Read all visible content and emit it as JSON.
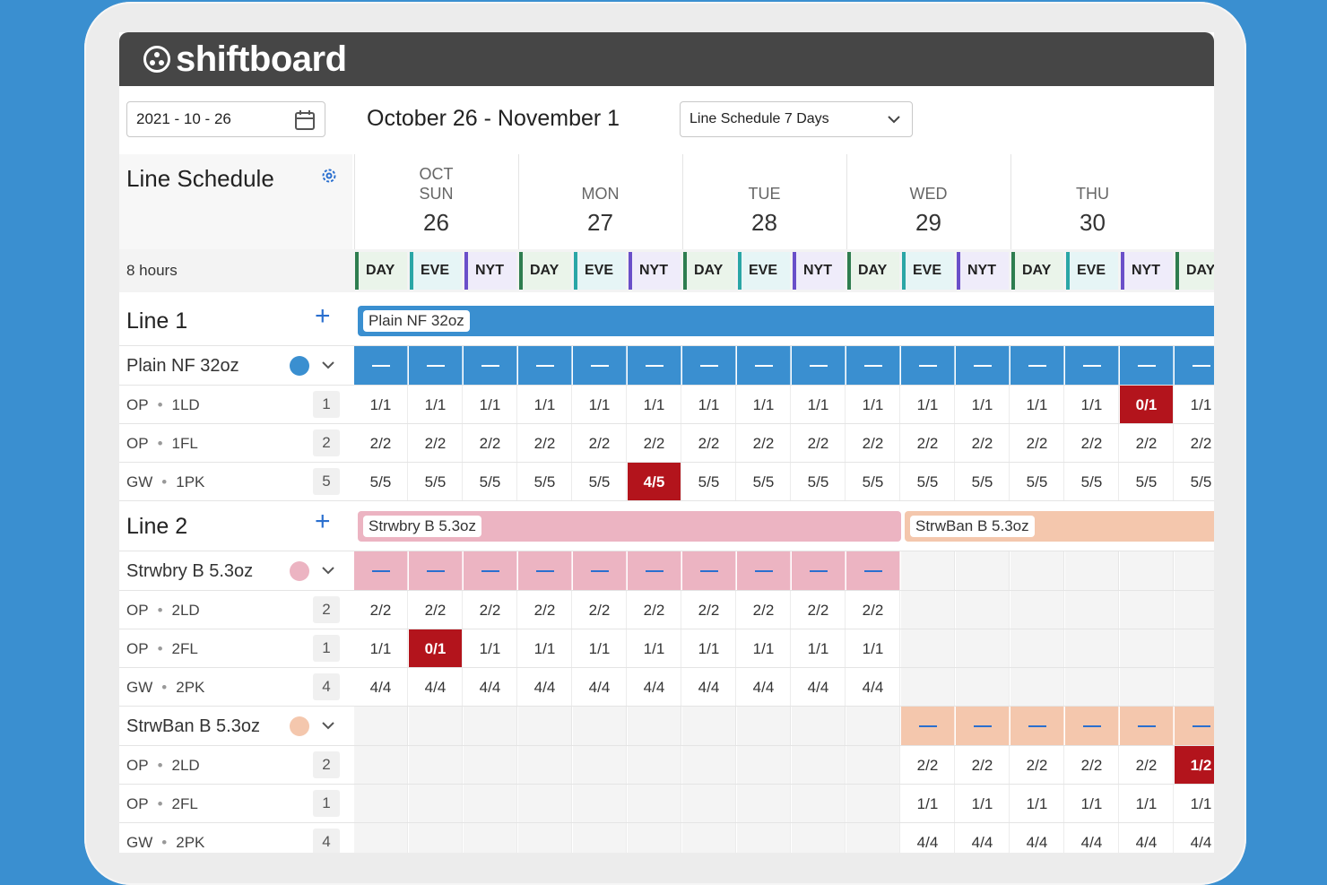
{
  "brand": {
    "name": "shiftboard"
  },
  "toolbar": {
    "date_value": "2021 - 10 - 26",
    "range_title": "October 26 - November 1",
    "view_select": "Line Schedule 7 Days"
  },
  "schedule": {
    "title": "Line Schedule",
    "hours_label": "8 hours",
    "days": [
      {
        "month": "OCT",
        "dow": "SUN",
        "num": "26"
      },
      {
        "month": "",
        "dow": "MON",
        "num": "27"
      },
      {
        "month": "",
        "dow": "TUE",
        "num": "28"
      },
      {
        "month": "",
        "dow": "WED",
        "num": "29"
      },
      {
        "month": "",
        "dow": "THU",
        "num": "30"
      }
    ],
    "shifts": [
      "DAY",
      "EVE",
      "NYT",
      "DAY",
      "EVE",
      "NYT",
      "DAY",
      "EVE",
      "NYT",
      "DAY",
      "EVE",
      "NYT",
      "DAY",
      "EVE",
      "NYT",
      "DAY"
    ]
  },
  "colors": {
    "product_blue": "#3a8fd0",
    "product_pink": "#ecb4c2",
    "product_peach": "#f4c7ad",
    "alert_red": "#b3141c"
  },
  "lines": [
    {
      "title": "Line 1",
      "bars": [
        {
          "label": "Plain NF 32oz",
          "color": "#3a8fd0",
          "start": 0,
          "span": 16
        }
      ],
      "products": [
        {
          "name": "Plain NF 32oz",
          "dot": "#3a8fd0",
          "color": "#3a8fd0",
          "dash_color": "#ffffff",
          "start": 0,
          "span": 16,
          "roles": [
            {
              "group": "OP",
              "code": "1LD",
              "count": "1",
              "values": [
                "1/1",
                "1/1",
                "1/1",
                "1/1",
                "1/1",
                "1/1",
                "1/1",
                "1/1",
                "1/1",
                "1/1",
                "1/1",
                "1/1",
                "1/1",
                "1/1",
                "0/1",
                "1/1"
              ],
              "alerts": [
                14
              ]
            },
            {
              "group": "OP",
              "code": "1FL",
              "count": "2",
              "values": [
                "2/2",
                "2/2",
                "2/2",
                "2/2",
                "2/2",
                "2/2",
                "2/2",
                "2/2",
                "2/2",
                "2/2",
                "2/2",
                "2/2",
                "2/2",
                "2/2",
                "2/2",
                "2/2"
              ],
              "alerts": []
            },
            {
              "group": "GW",
              "code": "1PK",
              "count": "5",
              "values": [
                "5/5",
                "5/5",
                "5/5",
                "5/5",
                "5/5",
                "4/5",
                "5/5",
                "5/5",
                "5/5",
                "5/5",
                "5/5",
                "5/5",
                "5/5",
                "5/5",
                "5/5",
                "5/5"
              ],
              "alerts": [
                5
              ]
            }
          ]
        }
      ]
    },
    {
      "title": "Line 2",
      "bars": [
        {
          "label": "Strwbry B 5.3oz",
          "color": "#ecb4c2",
          "start": 0,
          "span": 10
        },
        {
          "label": "StrwBan B 5.3oz",
          "color": "#f4c7ad",
          "start": 10,
          "span": 6
        }
      ],
      "products": [
        {
          "name": "Strwbry B 5.3oz",
          "dot": "#ecb4c2",
          "color": "#ecb4c2",
          "dash_color": "#2a6fcf",
          "start": 0,
          "span": 10,
          "roles": [
            {
              "group": "OP",
              "code": "2LD",
              "count": "2",
              "values": [
                "2/2",
                "2/2",
                "2/2",
                "2/2",
                "2/2",
                "2/2",
                "2/2",
                "2/2",
                "2/2",
                "2/2",
                "",
                "",
                "",
                "",
                "",
                ""
              ],
              "alerts": []
            },
            {
              "group": "OP",
              "code": "2FL",
              "count": "1",
              "values": [
                "1/1",
                "0/1",
                "1/1",
                "1/1",
                "1/1",
                "1/1",
                "1/1",
                "1/1",
                "1/1",
                "1/1",
                "",
                "",
                "",
                "",
                "",
                ""
              ],
              "alerts": [
                1
              ]
            },
            {
              "group": "GW",
              "code": "2PK",
              "count": "4",
              "values": [
                "4/4",
                "4/4",
                "4/4",
                "4/4",
                "4/4",
                "4/4",
                "4/4",
                "4/4",
                "4/4",
                "4/4",
                "",
                "",
                "",
                "",
                "",
                ""
              ],
              "alerts": []
            }
          ]
        },
        {
          "name": "StrwBan B 5.3oz",
          "dot": "#f4c7ad",
          "color": "#f4c7ad",
          "dash_color": "#2a6fcf",
          "start": 10,
          "span": 6,
          "roles": [
            {
              "group": "OP",
              "code": "2LD",
              "count": "2",
              "values": [
                "",
                "",
                "",
                "",
                "",
                "",
                "",
                "",
                "",
                "",
                "2/2",
                "2/2",
                "2/2",
                "2/2",
                "2/2",
                "1/2"
              ],
              "alerts": [
                15
              ]
            },
            {
              "group": "OP",
              "code": "2FL",
              "count": "1",
              "values": [
                "",
                "",
                "",
                "",
                "",
                "",
                "",
                "",
                "",
                "",
                "1/1",
                "1/1",
                "1/1",
                "1/1",
                "1/1",
                "1/1"
              ],
              "alerts": []
            },
            {
              "group": "GW",
              "code": "2PK",
              "count": "4",
              "values": [
                "",
                "",
                "",
                "",
                "",
                "",
                "",
                "",
                "",
                "",
                "4/4",
                "4/4",
                "4/4",
                "4/4",
                "4/4",
                "4/4"
              ],
              "alerts": []
            }
          ]
        }
      ]
    }
  ]
}
